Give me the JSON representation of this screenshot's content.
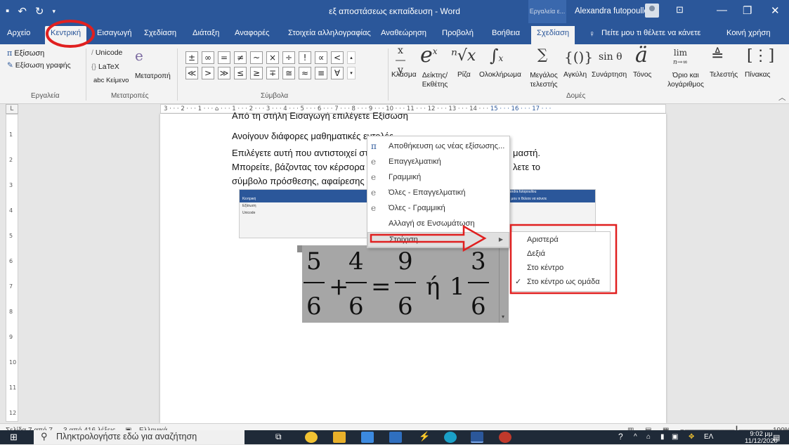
{
  "window": {
    "title": "εξ αποστάσεως εκπαίδευση - Word",
    "context_group": "Εργαλεία ε...",
    "user": "Alexandra futopoullou",
    "minimize": "—",
    "maximize": "❐",
    "close": "✕"
  },
  "tabs": [
    "Αρχείο",
    "Κεντρική",
    "Εισαγωγή",
    "Σχεδίαση",
    "Διάταξη",
    "Αναφορές",
    "Στοιχεία αλληλογραφίας",
    "Αναθεώρηση",
    "Προβολή",
    "Βοήθεια",
    "Σχεδίαση"
  ],
  "tell_me": "Πείτε μου τι θέλετε να κάνετε",
  "share": "Κοινή χρήση",
  "ribbon": {
    "tools": {
      "equation": "Εξίσωση",
      "ink_equation": "Εξίσωση γραφής",
      "group": "Εργαλεία"
    },
    "conversions": {
      "unicode": "Unicode",
      "latex": "LaTeX",
      "text": "abc Κείμενο",
      "convert": "Μετατροπή",
      "group": "Μετατροπές"
    },
    "symbols": {
      "group": "Σύμβολα",
      "row1": [
        "±",
        "∞",
        "=",
        "≠",
        "~",
        "×",
        "÷",
        "!",
        "∝",
        "<"
      ],
      "row2": [
        "≪",
        ">",
        "≫",
        "≤",
        "≥",
        "∓",
        "≅",
        "≈",
        "≡",
        "∀"
      ]
    },
    "structures": {
      "group": "Δομές",
      "items": [
        "Κλάσμα",
        "Δείκτης/ Εκθέτης",
        "Ρίζα",
        "Ολοκλήρωμα",
        "Μεγάλος τελεστής",
        "Αγκύλη",
        "Συνάρτηση",
        "Τόνος",
        "Όριο και λογάριθμος",
        "Τελεστής",
        "Πίνακας"
      ]
    }
  },
  "ruler": {
    "ticks": "3 · · · 2 · · · 1 · · · ⌂ · · · 1 · · · 2 · · · 3 · · · 4 · · · 5 · · · 6 · · · 7 · · · 8 · · · 9 · · · 10 · · · 11 · · · 12 · · · 13 · · · 14 · · · ",
    "tail": "15 · · · 16 · · · 17 · · ·"
  },
  "vruler_ticks": [
    "1",
    "2",
    "3",
    "4",
    "5",
    "6",
    "7",
    "8",
    "9",
    "10",
    "11",
    "12"
  ],
  "document": {
    "line1": "Από τη στήλη Εισαγωγή επιλέγετε Εξίσωση",
    "line2": "Ανοίγουν διάφορες μαθηματικές εντολές.",
    "line3a": "Επιλέγετε αυτή που αντιστοιχεί στο κ",
    "line3b": "μαστή.",
    "line4a": "Μπορείτε, βάζοντας τον κέρσορα στ",
    "line4b": "λετε το",
    "line5": "σύμβολο πρόσθεσης, αφαίρεσης κλπ"
  },
  "equation": {
    "n1": "5",
    "d1": "6",
    "op1": "+",
    "n2": "4",
    "d2": "6",
    "op2": "=",
    "n3": "9",
    "d3": "6",
    "word": "ή",
    "whole": "1",
    "n4": "3",
    "d4": "6"
  },
  "context_menu": [
    {
      "label": "Αποθήκευση ως νέας εξίσωσης...",
      "icon": "πₓ"
    },
    {
      "label": "Επαγγελματική",
      "icon": "e"
    },
    {
      "label": "Γραμμική",
      "icon": "e"
    },
    {
      "label": "Όλες - Επαγγελματική",
      "icon": "e"
    },
    {
      "label": "Όλες - Γραμμική",
      "icon": "e"
    },
    {
      "label": "Αλλαγή σε Ενσωμάτωση",
      "icon": ""
    },
    {
      "label": "Στοίχιση",
      "icon": ""
    }
  ],
  "submenu": [
    "Αριστερά",
    "Δεξιά",
    "Στο κέντρο",
    "Στο κέντρο ως ομάδα"
  ],
  "status": {
    "page": "Σελίδα 7 από 7",
    "words": "3 από 416 λέξεις",
    "lang": "Ελληνικά",
    "zoom": "100%"
  },
  "taskbar": {
    "search": "Πληκτρολογήστε εδώ για αναζήτηση",
    "lang": "ΕΛ",
    "time": "9:02 μμ",
    "date": "11/12/2020"
  },
  "colors": {
    "word_blue": "#2b579a",
    "annotation_red": "#e02020"
  }
}
